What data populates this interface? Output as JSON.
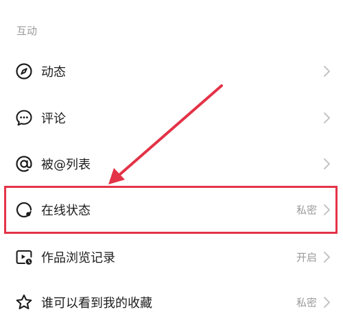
{
  "section": {
    "title": "互动"
  },
  "rows": [
    {
      "label": "动态",
      "value": "",
      "icon": "compass-icon"
    },
    {
      "label": "评论",
      "value": "",
      "icon": "comment-bubble-icon"
    },
    {
      "label": "被@列表",
      "value": "",
      "icon": "at-sign-icon"
    },
    {
      "label": "在线状态",
      "value": "私密",
      "icon": "online-status-icon"
    },
    {
      "label": "作品浏览记录",
      "value": "开启",
      "icon": "video-history-icon"
    },
    {
      "label": "谁可以看到我的收藏",
      "value": "私密",
      "icon": "star-icon"
    }
  ],
  "annotation": {
    "color": "#e33347"
  },
  "colors": {
    "text": "#1c1c1c",
    "muted": "#9a9a9a",
    "chevron": "#c4c4c4"
  }
}
